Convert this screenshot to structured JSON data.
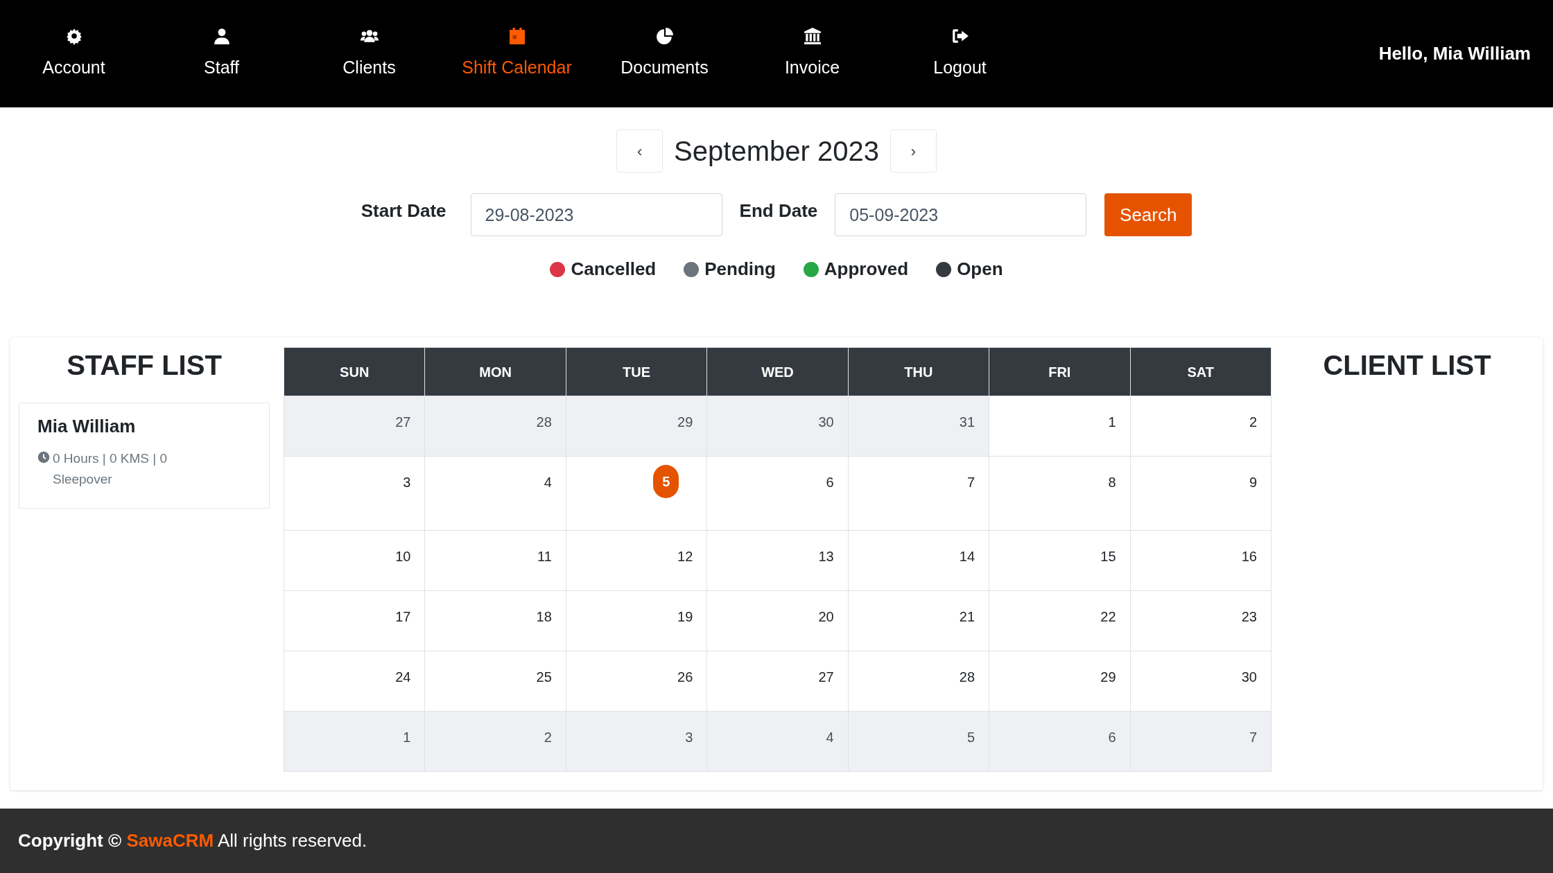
{
  "nav": {
    "items": [
      {
        "label": "Account",
        "selected": false
      },
      {
        "label": "Staff",
        "selected": false
      },
      {
        "label": "Clients",
        "selected": false
      },
      {
        "label": "Shift Calendar",
        "selected": true
      },
      {
        "label": "Documents",
        "selected": false
      },
      {
        "label": "Invoice",
        "selected": false
      },
      {
        "label": "Logout",
        "selected": false
      }
    ],
    "greeting": "Hello, Mia William"
  },
  "month_nav": {
    "prev": "‹",
    "title": "September 2023",
    "next": "›"
  },
  "filter": {
    "start_label": "Start Date",
    "start_value": "29-08-2023",
    "end_label": "End Date",
    "end_value": "05-09-2023",
    "search": "Search"
  },
  "legend": [
    {
      "label": "Cancelled",
      "color": "#dc3545"
    },
    {
      "label": "Pending",
      "color": "#6c757d"
    },
    {
      "label": "Approved",
      "color": "#28a745"
    },
    {
      "label": "Open",
      "color": "#343a40"
    }
  ],
  "staff_list": {
    "title": "STAFF LIST",
    "staff": [
      {
        "name": "Mia William",
        "stats": "0 Hours | 0 KMS | 0 Sleepover"
      }
    ]
  },
  "calendar": {
    "days": [
      "SUN",
      "MON",
      "TUE",
      "WED",
      "THU",
      "FRI",
      "SAT"
    ],
    "weeks": [
      [
        {
          "day": "27",
          "outside": true,
          "today": false
        },
        {
          "day": "28",
          "outside": true,
          "today": false
        },
        {
          "day": "29",
          "outside": true,
          "today": false
        },
        {
          "day": "30",
          "outside": true,
          "today": false
        },
        {
          "day": "31",
          "outside": true,
          "today": false
        },
        {
          "day": "1",
          "outside": false,
          "today": false
        },
        {
          "day": "2",
          "outside": false,
          "today": false
        }
      ],
      [
        {
          "day": "3",
          "outside": false,
          "today": false
        },
        {
          "day": "4",
          "outside": false,
          "today": false
        },
        {
          "day": "5",
          "outside": false,
          "today": true
        },
        {
          "day": "6",
          "outside": false,
          "today": false
        },
        {
          "day": "7",
          "outside": false,
          "today": false
        },
        {
          "day": "8",
          "outside": false,
          "today": false
        },
        {
          "day": "9",
          "outside": false,
          "today": false
        }
      ],
      [
        {
          "day": "10",
          "outside": false,
          "today": false
        },
        {
          "day": "11",
          "outside": false,
          "today": false
        },
        {
          "day": "12",
          "outside": false,
          "today": false
        },
        {
          "day": "13",
          "outside": false,
          "today": false
        },
        {
          "day": "14",
          "outside": false,
          "today": false
        },
        {
          "day": "15",
          "outside": false,
          "today": false
        },
        {
          "day": "16",
          "outside": false,
          "today": false
        }
      ],
      [
        {
          "day": "17",
          "outside": false,
          "today": false
        },
        {
          "day": "18",
          "outside": false,
          "today": false
        },
        {
          "day": "19",
          "outside": false,
          "today": false
        },
        {
          "day": "20",
          "outside": false,
          "today": false
        },
        {
          "day": "21",
          "outside": false,
          "today": false
        },
        {
          "day": "22",
          "outside": false,
          "today": false
        },
        {
          "day": "23",
          "outside": false,
          "today": false
        }
      ],
      [
        {
          "day": "24",
          "outside": false,
          "today": false
        },
        {
          "day": "25",
          "outside": false,
          "today": false
        },
        {
          "day": "26",
          "outside": false,
          "today": false
        },
        {
          "day": "27",
          "outside": false,
          "today": false
        },
        {
          "day": "28",
          "outside": false,
          "today": false
        },
        {
          "day": "29",
          "outside": false,
          "today": false
        },
        {
          "day": "30",
          "outside": false,
          "today": false
        }
      ],
      [
        {
          "day": "1",
          "outside": true,
          "today": false
        },
        {
          "day": "2",
          "outside": true,
          "today": false
        },
        {
          "day": "3",
          "outside": true,
          "today": false
        },
        {
          "day": "4",
          "outside": true,
          "today": false
        },
        {
          "day": "5",
          "outside": true,
          "today": false
        },
        {
          "day": "6",
          "outside": true,
          "today": false
        },
        {
          "day": "7",
          "outside": true,
          "today": false
        }
      ]
    ]
  },
  "client_list": {
    "title": "CLIENT LIST"
  },
  "footer": {
    "prefix": "Copyright ©",
    "brand": "SawaCRM",
    "suffix": "All rights reserved."
  }
}
